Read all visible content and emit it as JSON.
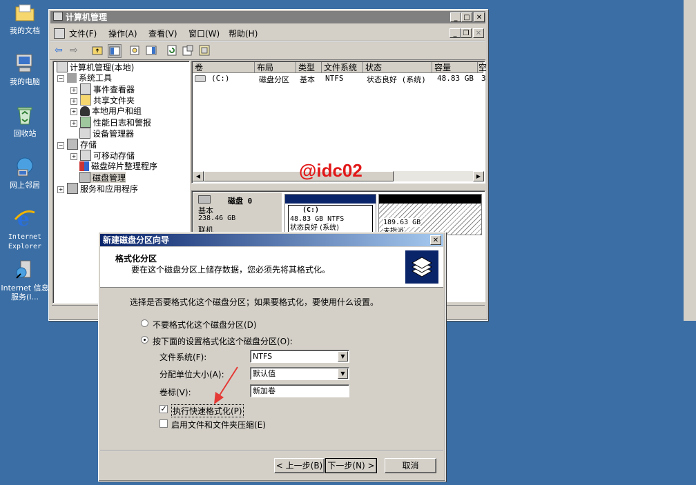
{
  "desktop": {
    "icons": [
      {
        "label": "我的文档"
      },
      {
        "label": "我的电脑"
      },
      {
        "label": "回收站"
      },
      {
        "label": "网上邻居"
      },
      {
        "label": "Internet Explorer"
      },
      {
        "label": "Internet 信息服务(I..."
      }
    ]
  },
  "mgmt": {
    "title": "计算机管理",
    "menu": [
      "文件(F)",
      "操作(A)",
      "查看(V)",
      "窗口(W)",
      "帮助(H)"
    ],
    "tree": {
      "root": "计算机管理(本地)",
      "system_tools": "系统工具",
      "event_viewer": "事件查看器",
      "shared_folders": "共享文件夹",
      "local_users": "本地用户和组",
      "perf_logs": "性能日志和警报",
      "device_manager": "设备管理器",
      "storage": "存储",
      "removable": "可移动存储",
      "defrag": "磁盘碎片整理程序",
      "disk_mgmt": "磁盘管理",
      "services": "服务和应用程序"
    },
    "columns": [
      "卷",
      "布局",
      "类型",
      "文件系统",
      "状态",
      "容量",
      "空"
    ],
    "row": [
      "(C:)",
      "磁盘分区",
      "基本",
      "NTFS",
      "状态良好 (系统)",
      "48.83 GB",
      "3"
    ],
    "watermark": "@idc02",
    "disk": {
      "name": "磁盘 0",
      "type": "基本",
      "size": "238.46 GB",
      "status": "联机"
    },
    "partition_c": {
      "name": "(C:)",
      "size": "48.83 GB NTFS",
      "status": "状态良好 (系统)"
    },
    "unallocated": {
      "size": "189.63 GB",
      "status": "未指派"
    }
  },
  "wizard": {
    "title": "新建磁盘分区向导",
    "header_title": "格式化分区",
    "header_desc": "要在这个磁盘分区上储存数据，您必须先将其格式化。",
    "intro": "选择是否要格式化这个磁盘分区；如果要格式化，要使用什么设置。",
    "opt_no_format": "不要格式化这个磁盘分区(D)",
    "opt_format": "按下面的设置格式化这个磁盘分区(O):",
    "fs_label": "文件系统(F):",
    "fs_value": "NTFS",
    "alloc_label": "分配单位大小(A):",
    "alloc_value": "默认值",
    "vol_label": "卷标(V):",
    "vol_value": "新加卷",
    "quick_format": "执行快速格式化(P)",
    "compress": "启用文件和文件夹压缩(E)",
    "back": "< 上一步(B)",
    "next": "下一步(N) >",
    "cancel": "取消",
    "quick_checked": true,
    "format_selected": true
  }
}
